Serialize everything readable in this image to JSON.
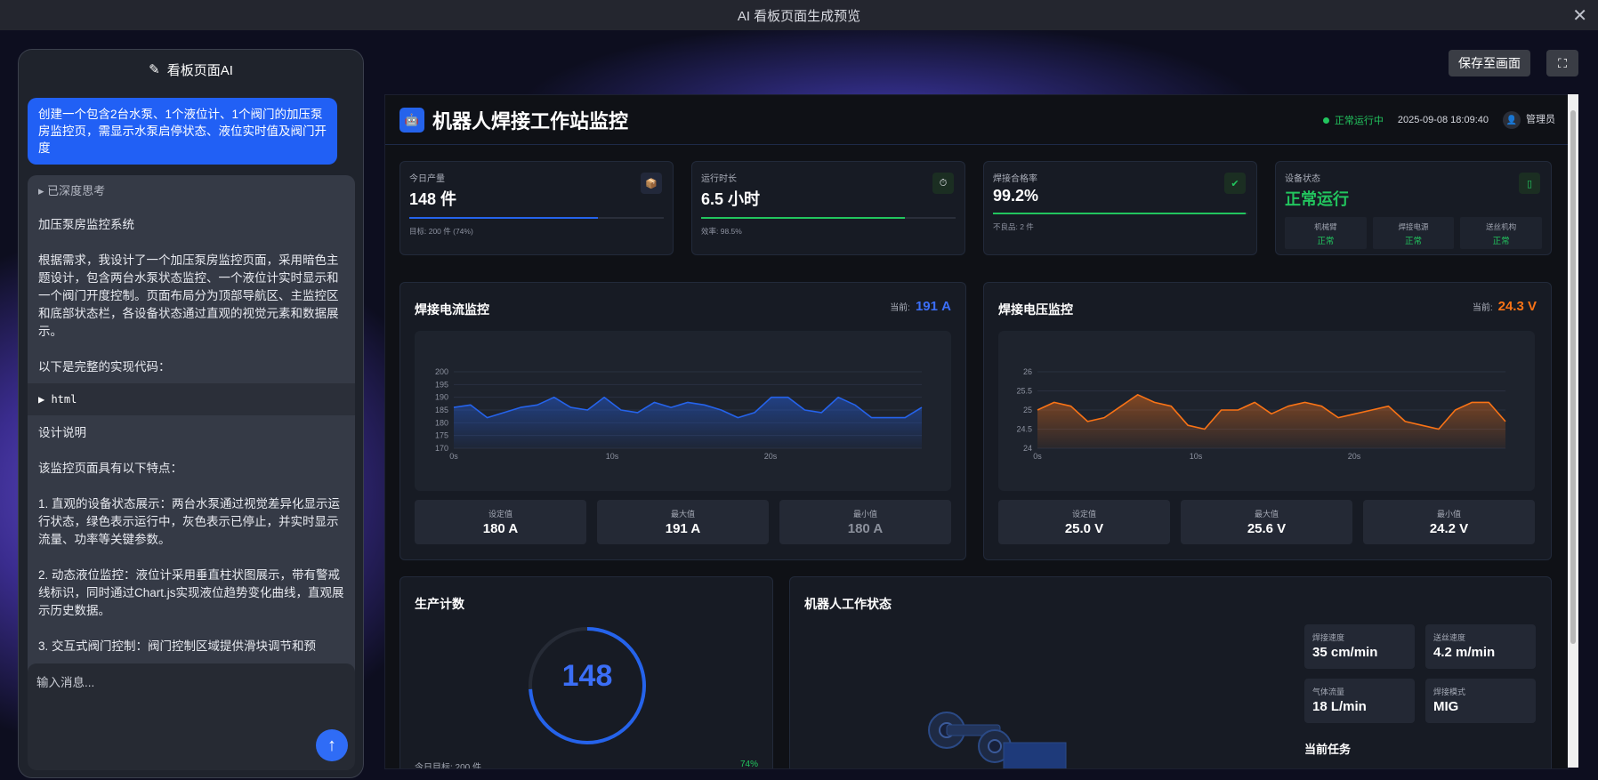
{
  "window": {
    "title": "AI 看板页面生成预览"
  },
  "chat": {
    "header": "看板页面AI",
    "user_message": "创建一个包含2台水泵、1个液位计、1个阀门的加压泵房监控页，需显示水泵启停状态、液位实时值及阀门开度",
    "think_label": "▸ 已深度思考",
    "paragraphs_a": [
      "加压泵房监控系统",
      "根据需求，我设计了一个加压泵房监控页面，采用暗色主题设计，包含两台水泵状态监控、一个液位计实时显示和一个阀门开度控制。页面布局分为顶部导航区、主监控区和底部状态栏，各设备状态通过直观的视觉元素和数据展示。",
      "以下是完整的实现代码："
    ],
    "code_label": "▶ html",
    "paragraphs_b": [
      "设计说明",
      "该监控页面具有以下特点：",
      "1. 直观的设备状态展示：两台水泵通过视觉差异化显示运行状态，绿色表示运行中，灰色表示已停止，并实时显示流量、功率等关键参数。",
      "2. 动态液位监控：液位计采用垂直柱状图展示，带有警戒线标识，同时通过Chart.js实现液位趋势变化曲线，直观展示历史数据。",
      "3. 交互式阀门控制：阀门控制区域提供滑块调节和预"
    ],
    "input_placeholder": "输入消息..."
  },
  "toolbar": {
    "save_label": "保存至画面",
    "fullscreen_icon": "fullscreen-icon"
  },
  "dashboard": {
    "title": "机器人焊接工作站监控",
    "status": "正常运行中",
    "datetime": "2025-09-08 18:09:40",
    "user": "管理员",
    "kpis": [
      {
        "label": "今日产量",
        "value": "148 件",
        "sub": "目标: 200 件 (74%)",
        "progress": 0.74,
        "color": "#2563eb"
      },
      {
        "label": "运行时长",
        "value": "6.5 小时",
        "sub": "效率: 98.5%",
        "progress": 0.8,
        "color": "#22c55e"
      },
      {
        "label": "焊接合格率",
        "value": "99.2%",
        "sub": "不良品: 2 件",
        "progress": 0.992,
        "color": "#22c55e"
      }
    ],
    "device": {
      "label": "设备状态",
      "value": "正常运行",
      "items": [
        {
          "name": "机械臂",
          "state": "正常"
        },
        {
          "name": "焊接电源",
          "state": "正常"
        },
        {
          "name": "送丝机构",
          "state": "正常"
        }
      ]
    },
    "current_panel": {
      "title": "焊接电流监控",
      "current_label": "当前:",
      "current_value": "191 A",
      "stats": [
        {
          "label": "设定值",
          "value": "180 A"
        },
        {
          "label": "最大值",
          "value": "191 A"
        },
        {
          "label": "最小值",
          "value": "180 A"
        }
      ]
    },
    "voltage_panel": {
      "title": "焊接电压监控",
      "current_label": "当前:",
      "current_value": "24.3 V",
      "stats": [
        {
          "label": "设定值",
          "value": "25.0 V"
        },
        {
          "label": "最大值",
          "value": "25.6 V"
        },
        {
          "label": "最小值",
          "value": "24.2 V"
        }
      ]
    },
    "production": {
      "title": "生产计数",
      "count": "148",
      "target": "今日目标: 200 件",
      "percent": "74%",
      "progress": 0.74
    },
    "robot": {
      "title": "机器人工作状态",
      "task_label": "当前任务",
      "params": [
        {
          "label": "焊接速度",
          "value": "35 cm/min"
        },
        {
          "label": "送丝速度",
          "value": "4.2 m/min"
        },
        {
          "label": "气体流量",
          "value": "18 L/min"
        },
        {
          "label": "焊接模式",
          "value": "MIG"
        }
      ]
    }
  },
  "chart_data": [
    {
      "type": "area",
      "x_ticks": [
        "0s",
        "10s",
        "20s"
      ],
      "ylim": [
        170,
        200
      ],
      "y_ticks": [
        170,
        175,
        180,
        185,
        190,
        195,
        200
      ],
      "color": "#2563eb",
      "series": [
        {
          "values": [
            186,
            187,
            182,
            184,
            186,
            187,
            190,
            186,
            185,
            190,
            185,
            184,
            188,
            186,
            188,
            187,
            185,
            182,
            184,
            190,
            190,
            185,
            184,
            190,
            187,
            182,
            182,
            182,
            186
          ]
        }
      ]
    },
    {
      "type": "area",
      "x_ticks": [
        "0s",
        "10s",
        "20s"
      ],
      "ylim": [
        24,
        26
      ],
      "y_ticks": [
        24,
        24.5,
        25,
        25.5,
        26
      ],
      "color": "#f97316",
      "series": [
        {
          "values": [
            25.0,
            25.2,
            25.1,
            24.7,
            24.8,
            25.1,
            25.4,
            25.2,
            25.1,
            24.6,
            24.5,
            25.0,
            25.0,
            25.2,
            24.9,
            25.1,
            25.2,
            25.1,
            24.8,
            24.9,
            25.0,
            25.1,
            24.7,
            24.6,
            24.5,
            25.0,
            25.2,
            25.2,
            24.7
          ]
        }
      ]
    }
  ]
}
